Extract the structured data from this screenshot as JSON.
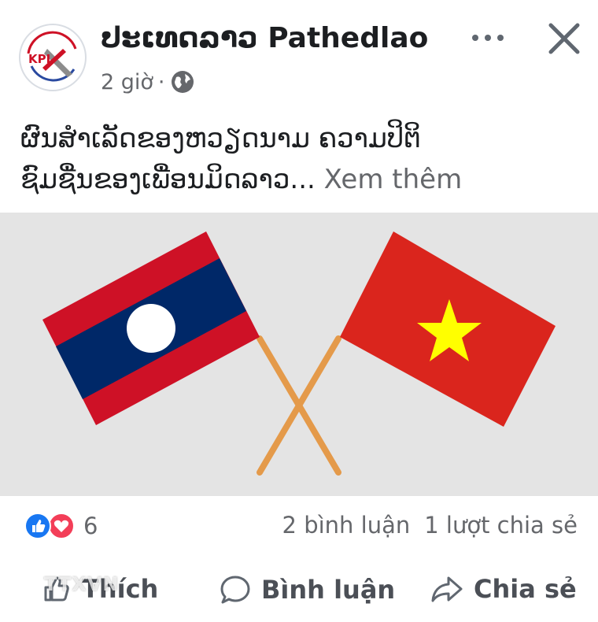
{
  "post": {
    "page_name": "ປະເທດລາວ Pathedlao",
    "time": "2 giờ",
    "separator": "·",
    "avatar_text": "KPL",
    "text_line1": "ຜົນສໍາເລັດຂອງຫວຽດນາມ  ຄວາມປິຕິ",
    "text_line2_prefix": "ຊົມຊື່ນຂອງເພື່ອນມິດລາວ...",
    "see_more": "Xem thêm"
  },
  "stats": {
    "reaction_count": "6",
    "comments": "2 bình luận",
    "shares": "1 lượt chia sẻ"
  },
  "actions": {
    "like": "Thích",
    "comment": "Bình luận",
    "share": "Chia sẻ"
  },
  "watermark": "TTXVN",
  "colors": {
    "facebook_blue": "#1877f2",
    "love_red": "#f33e58",
    "laos_red": "#ce1126",
    "laos_blue": "#002868",
    "vietnam_red": "#da251d",
    "vietnam_star": "#ffff00",
    "pole": "#e49a4a"
  }
}
